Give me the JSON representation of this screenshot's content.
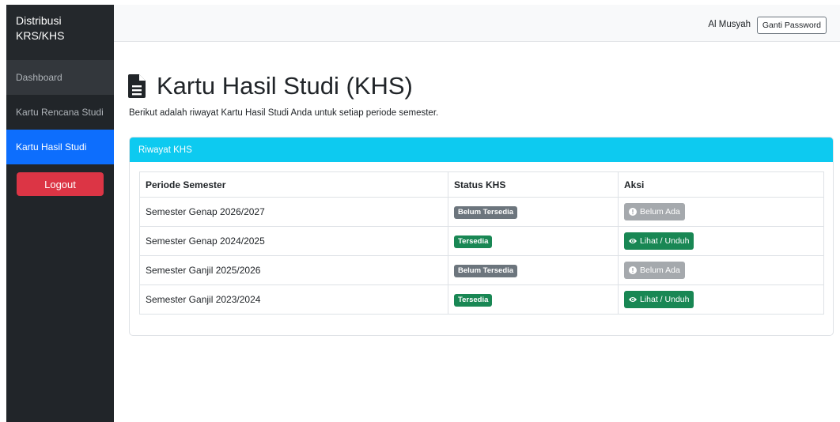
{
  "sidebar": {
    "brand_line1": "Distribusi",
    "brand_line2": "KRS/KHS",
    "items": [
      {
        "label": "Dashboard"
      },
      {
        "label": "Kartu Rencana Studi"
      },
      {
        "label": "Kartu Hasil Studi"
      }
    ],
    "logout_label": "Logout"
  },
  "header": {
    "user_name": "Al Musyah",
    "change_password_label": "Ganti Password"
  },
  "main": {
    "title": "Kartu Hasil Studi (KHS)",
    "title_icon": "file-text-icon",
    "subtitle": "Berikut adalah riwayat Kartu Hasil Studi Anda untuk setiap periode semester.",
    "card_title": "Riwayat KHS",
    "table": {
      "headers": [
        "Periode Semester",
        "Status KHS",
        "Aksi"
      ],
      "rows": [
        {
          "period": "Semester Genap 2026/2027",
          "status": "Belum Tersedia",
          "action": "Belum Ada"
        },
        {
          "period": "Semester Genap 2024/2025",
          "status": "Tersedia",
          "action": "Lihat / Unduh"
        },
        {
          "period": "Semester Ganjil 2025/2026",
          "status": "Belum Tersedia",
          "action": "Belum Ada"
        },
        {
          "period": "Semester Ganjil 2023/2024",
          "status": "Tersedia",
          "action": "Lihat / Unduh"
        }
      ]
    }
  },
  "colors": {
    "sidebar_bg": "#212529",
    "active_nav": "#0d6efd",
    "logout": "#dc3545",
    "card_header": "#0dcaf0",
    "badge_unavailable": "#6c757d",
    "badge_available": "#198754",
    "button_disabled": "#a5a9ad",
    "button_view": "#198754"
  }
}
